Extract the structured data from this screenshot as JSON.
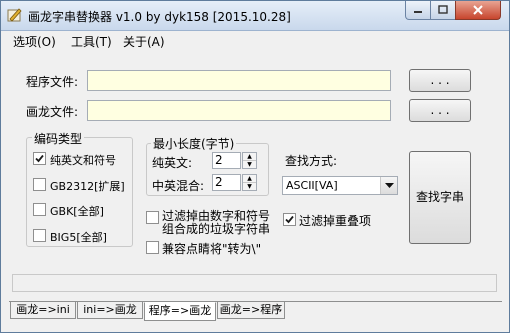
{
  "window": {
    "title": "画龙字串替换器 v1.0 by dyk158 [2015.10.28]"
  },
  "menu": [
    {
      "label": "选项(O)"
    },
    {
      "label": "工具(T)"
    },
    {
      "label": "关于(A)"
    }
  ],
  "fields": {
    "program_file_label": "程序文件:",
    "program_file_value": "",
    "dragon_file_label": "画龙文件:",
    "dragon_file_value": "",
    "browse1_label": ". . .",
    "browse2_label": ". . ."
  },
  "encoding": {
    "title": "编码类型",
    "options": [
      {
        "label": "纯英文和符号",
        "checked": true
      },
      {
        "label": "GB2312[扩展]",
        "checked": false
      },
      {
        "label": "GBK[全部]",
        "checked": false
      },
      {
        "label": "BIG5[全部]",
        "checked": false
      }
    ]
  },
  "min_length": {
    "title": "最小长度(字节)",
    "english_label": "纯英文:",
    "english_value": "2",
    "mixed_label": "中英混合:",
    "mixed_value": "2"
  },
  "search": {
    "mode_label": "查找方式:",
    "mode_value": "ASCII[VA]",
    "find_button": "查找字串"
  },
  "filters": {
    "filter_num_line1": "过滤掉由数字和符号",
    "filter_num_line2": "组合成的垃圾字符串",
    "filter_num_checked": false,
    "filter_dup_label": "过滤掉重叠项",
    "filter_dup_checked": true,
    "compat_label": "兼容点睛将\"转为\\\"",
    "compat_checked": false
  },
  "tabs": [
    {
      "label": "画龙=>ini",
      "active": false
    },
    {
      "label": "ini=>画龙",
      "active": false
    },
    {
      "label": "程序=>画龙",
      "active": true
    },
    {
      "label": "画龙=>程序",
      "active": false
    }
  ]
}
